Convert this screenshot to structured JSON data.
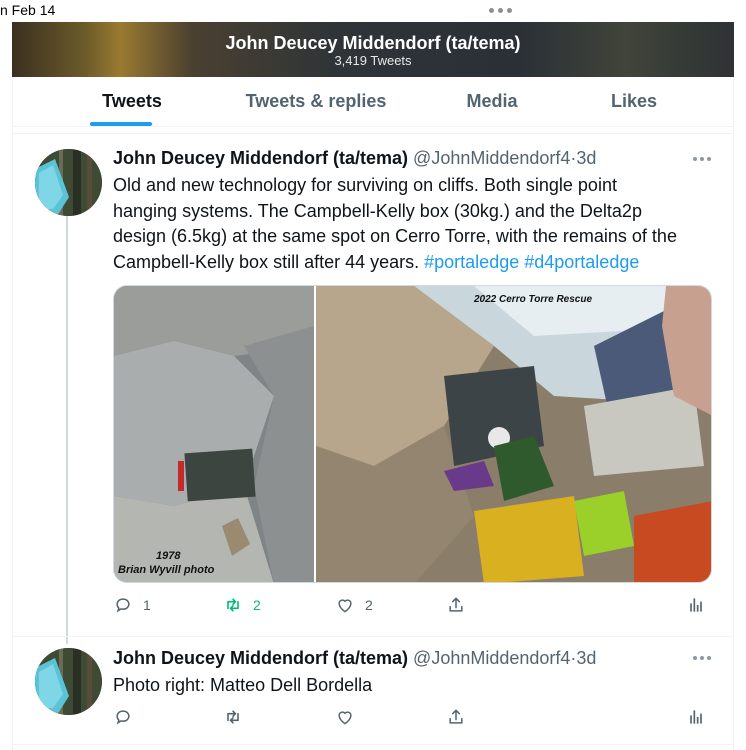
{
  "status_bar": {
    "date": "n Feb 14"
  },
  "profile": {
    "name": "John Deucey Middendorf (ta/tema)",
    "tweet_count": "3,419 Tweets"
  },
  "tabs": [
    {
      "label": "Tweets",
      "active": true
    },
    {
      "label": "Tweets & replies",
      "active": false
    },
    {
      "label": "Media",
      "active": false
    },
    {
      "label": "Likes",
      "active": false
    }
  ],
  "tweets": [
    {
      "name": "John Deucey Middendorf (ta/tema)",
      "handle": "@JohnMiddendorf4",
      "sep": "·",
      "time": "3d",
      "text_lines": [
        "Old and new technology for surviving on cliffs.  Both single point",
        "hanging systems.  The Campbell-Kelly box (30kg.) and the Delta2p",
        "design (6.5kg) at the same spot on Cerro Torre, with the remains of the"
      ],
      "text_last": "Campbell-Kelly box still after 44 years.",
      "hashtags": [
        "#portaledge",
        "#d4portaledge"
      ],
      "media": {
        "left_caption_year": "1978",
        "left_caption_credit": "Brian Wyvill photo",
        "right_caption": "2022 Cerro Torre Rescue"
      },
      "reply_count": "1",
      "retweet_count": "2",
      "like_count": "2",
      "retweet_active": true
    },
    {
      "name": "John Deucey Middendorf (ta/tema)",
      "handle": "@JohnMiddendorf4",
      "sep": "·",
      "time": "3d",
      "text": "Photo right: Matteo Dell Bordella",
      "reply_count": "",
      "retweet_count": "",
      "like_count": ""
    }
  ],
  "icons": {
    "reply": "reply-icon",
    "retweet": "retweet-icon",
    "like": "heart-icon",
    "share": "share-icon",
    "analytics": "analytics-icon",
    "more": "more-icon"
  },
  "colors": {
    "accent": "#1d9bf0",
    "retweet_active": "#00ba7c",
    "secondary_text": "#536471"
  }
}
